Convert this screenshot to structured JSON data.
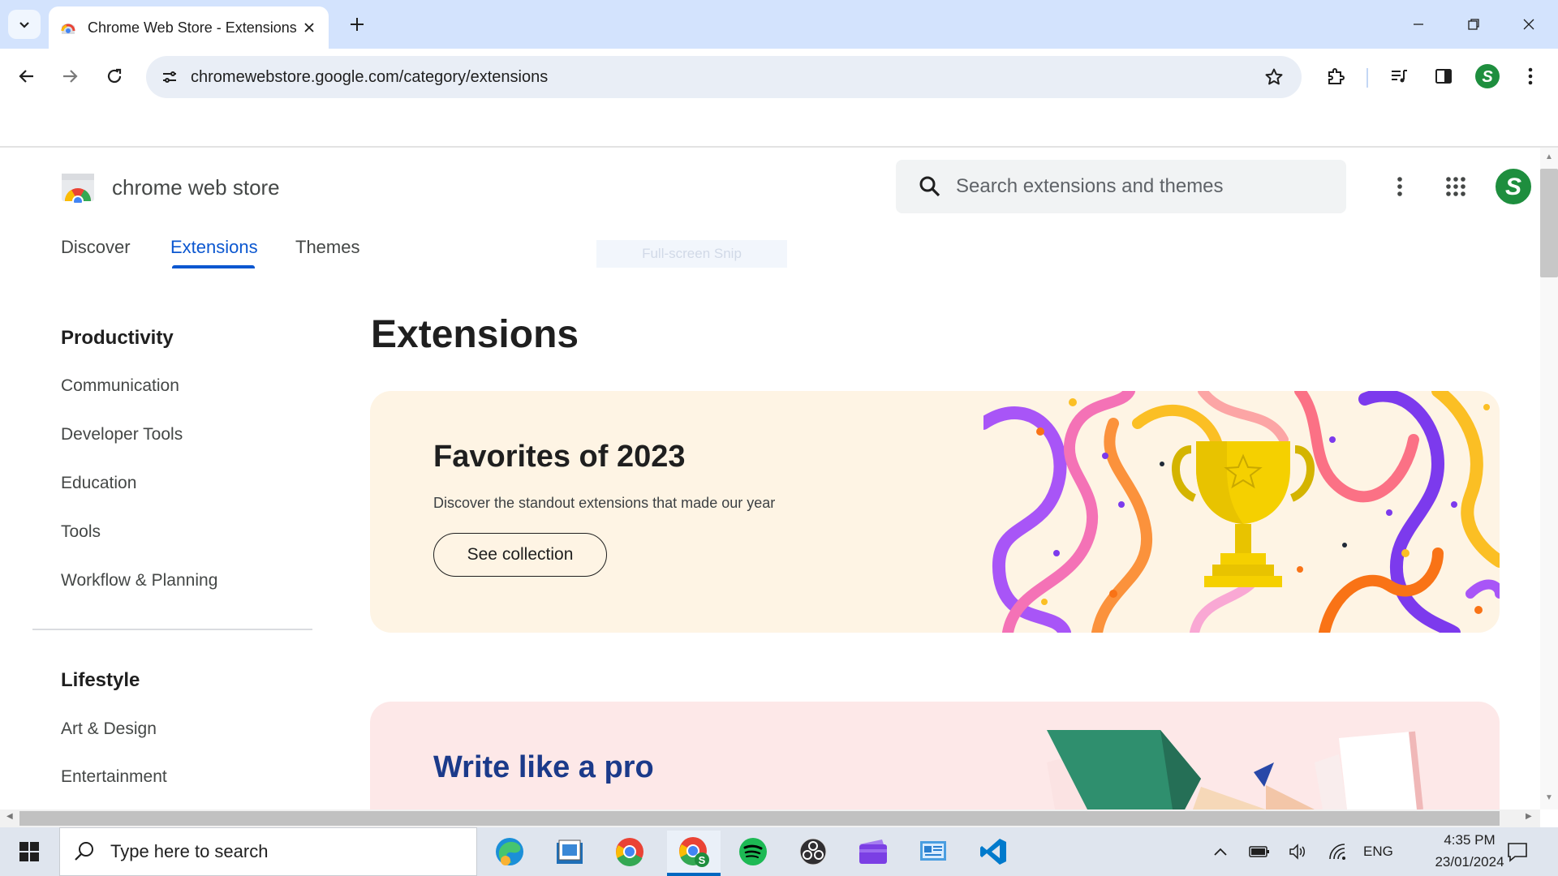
{
  "browser": {
    "tab_title": "Chrome Web Store - Extensions",
    "url": "chromewebstore.google.com/category/extensions",
    "profile_initial": "S"
  },
  "header": {
    "store_name": "chrome web store",
    "search_placeholder": "Search extensions and themes",
    "avatar_initial": "S"
  },
  "nav": {
    "tabs": [
      {
        "label": "Discover",
        "active": false
      },
      {
        "label": "Extensions",
        "active": true
      },
      {
        "label": "Themes",
        "active": false
      }
    ],
    "overlay_text": "Full-screen Snip"
  },
  "sidebar": {
    "sections": [
      {
        "heading": "Productivity",
        "items": [
          "Communication",
          "Developer Tools",
          "Education",
          "Tools",
          "Workflow & Planning"
        ]
      },
      {
        "heading": "Lifestyle",
        "items": [
          "Art & Design",
          "Entertainment"
        ]
      }
    ]
  },
  "main": {
    "title": "Extensions",
    "cards": [
      {
        "title": "Favorites of 2023",
        "description": "Discover the standout extensions that made our year",
        "button": "See collection"
      },
      {
        "title": "Write like a pro"
      }
    ]
  },
  "taskbar": {
    "search_placeholder": "Type here to search",
    "apps": [
      "edge-icon",
      "file-explorer-icon",
      "chrome-icon",
      "chrome-profile-icon",
      "spotify-icon",
      "obs-icon",
      "clipchamp-icon",
      "control-panel-icon",
      "vscode-icon"
    ],
    "language": "ENG",
    "time": "4:35 PM",
    "date": "23/01/2024"
  },
  "colors": {
    "accent": "#0b57d0",
    "tabbar": "#d3e3fd",
    "card1_bg": "#fef4e4",
    "card2_bg": "#fde8e8",
    "profile_green": "#1e8e3e"
  }
}
